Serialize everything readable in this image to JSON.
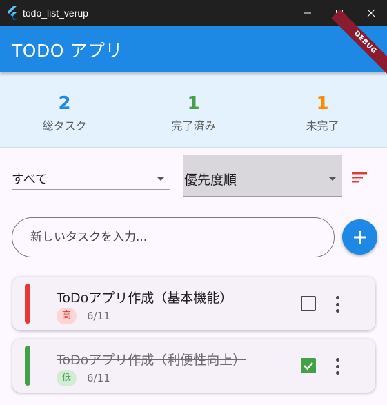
{
  "window": {
    "title": "todo_list_verup",
    "icon": "flutter-logo-icon"
  },
  "appbar": {
    "title": "TODO アプリ",
    "debug_banner": "DEBUG",
    "color": "#1e88e5"
  },
  "stats": [
    {
      "value": "2",
      "label": "総タスク",
      "color": "#1e88e5"
    },
    {
      "value": "1",
      "label": "完了済み",
      "color": "#43a047"
    },
    {
      "value": "1",
      "label": "未完了",
      "color": "#fb8c00"
    }
  ],
  "filter": {
    "selected": "すべて"
  },
  "sort": {
    "selected": "優先度順",
    "icon": "sort-icon",
    "icon_color": "#e53935"
  },
  "new_task": {
    "placeholder": "新しいタスクを入力...",
    "value": ""
  },
  "tasks": [
    {
      "title": "ToDoアプリ作成（基本機能）",
      "priority": "高",
      "priority_color": "#e53935",
      "date": "6/11",
      "completed": false
    },
    {
      "title": "ToDoアプリ作成（利便性向上）",
      "priority": "低",
      "priority_color": "#43a047",
      "date": "6/11",
      "completed": true
    }
  ]
}
